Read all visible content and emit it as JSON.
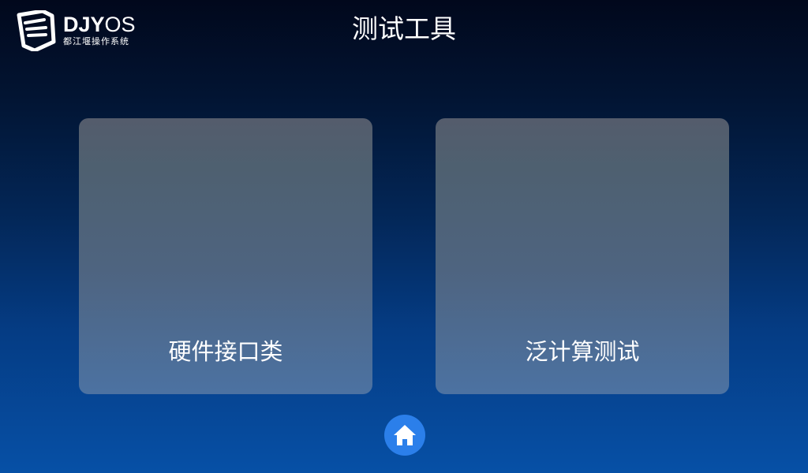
{
  "header": {
    "logo": {
      "brand_prefix": "DJY",
      "brand_suffix": "OS",
      "subtitle": "都江堰操作系统"
    },
    "title": "测试工具"
  },
  "cards": [
    {
      "label": "硬件接口类",
      "icon": "none"
    },
    {
      "label": "泛计算测试",
      "icon": "none"
    }
  ],
  "footer": {
    "home_icon": "home-icon"
  },
  "colors": {
    "background_top": "#01081c",
    "background_bottom": "#0650a6",
    "card_top": "#545c6c",
    "card_bottom": "#4c72a2",
    "home_button": "#2b7fea",
    "text": "#ffffff"
  }
}
